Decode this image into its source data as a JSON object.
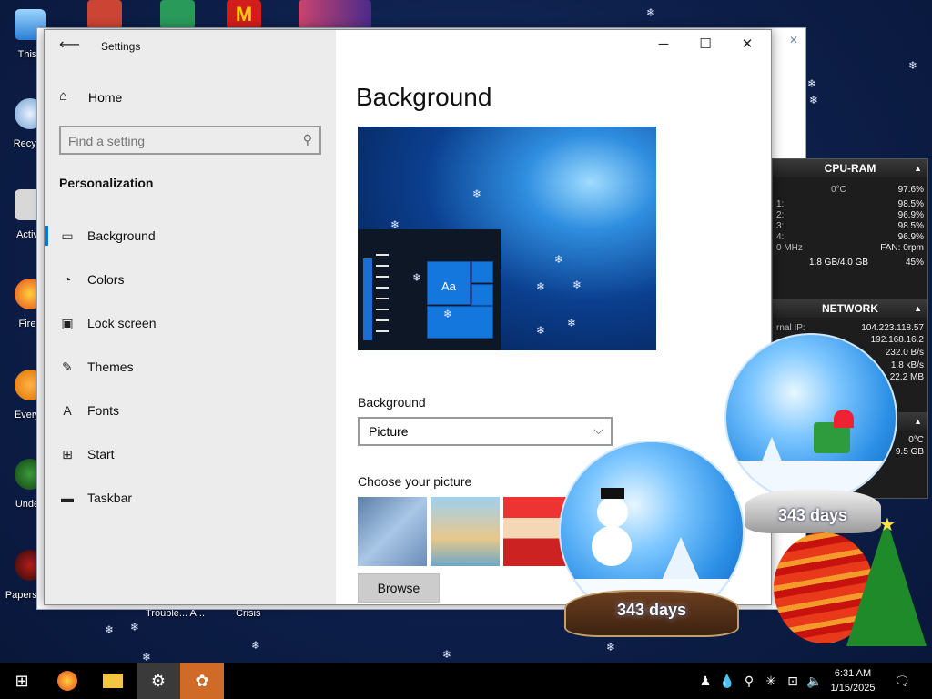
{
  "desktop": {
    "icons": [
      {
        "label": "This"
      },
      {
        "label": "Recyc"
      },
      {
        "label": "Activ"
      },
      {
        "label": "Fire"
      },
      {
        "label": "Every"
      },
      {
        "label": "Unde"
      },
      {
        "label": "Papers, P"
      },
      {
        "label": "Trouble... A..."
      },
      {
        "label": "Crisis"
      }
    ]
  },
  "settings": {
    "window_title": "Settings",
    "home_label": "Home",
    "search_placeholder": "Find a setting",
    "section_title": "Personalization",
    "nav": [
      {
        "label": "Background",
        "icon": "picture-icon"
      },
      {
        "label": "Colors",
        "icon": "palette-icon"
      },
      {
        "label": "Lock screen",
        "icon": "lock-screen-icon"
      },
      {
        "label": "Themes",
        "icon": "themes-icon"
      },
      {
        "label": "Fonts",
        "icon": "fonts-icon"
      },
      {
        "label": "Start",
        "icon": "start-icon"
      },
      {
        "label": "Taskbar",
        "icon": "taskbar-icon"
      }
    ],
    "active_nav": "Background",
    "page_title": "Background",
    "preview_tile_text": "Aa",
    "background_label": "Background",
    "background_value": "Picture",
    "choose_label": "Choose your picture",
    "browse_label": "Browse"
  },
  "gadgets": {
    "cpu_ram": {
      "title": "CPU-RAM",
      "temp": "0°C",
      "total": "97.6%",
      "cores": [
        {
          "label": "1:",
          "value": "98.5%"
        },
        {
          "label": "2:",
          "value": "96.9%"
        },
        {
          "label": "3:",
          "value": "98.5%"
        },
        {
          "label": "4:",
          "value": "96.9%"
        }
      ],
      "freq": "0 MHz",
      "fan": "FAN: 0rpm",
      "ram": "1.8 GB/4.0 GB",
      "ram_pct": "45%"
    },
    "network": {
      "title": "NETWORK",
      "external_ip_label": "rnal IP:",
      "external_ip": "104.223.118.57",
      "ip": "192.168.16.2",
      "down": "232.0 B/s",
      "up": "1.8 kB/s",
      "total": "22.2 MB"
    },
    "drive": {
      "temp": "0°C",
      "size": "9.5 GB"
    }
  },
  "globes": {
    "front_days": "343 days",
    "back_days": "343 days"
  },
  "taskbar": {
    "time": "6:31 AM",
    "date": "1/15/2025"
  },
  "colors": {
    "accent": "#0078d7",
    "sidebar_bg": "#ececec",
    "taskbar_bg": "#000000"
  }
}
